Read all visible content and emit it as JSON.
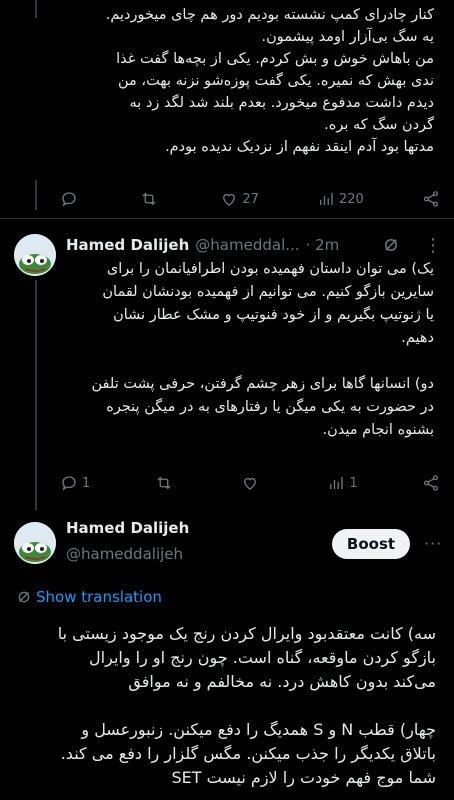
{
  "tweet1": {
    "text_lines": "کنار چادرای کمپ نشسته بودیم دور هم چای میخوردیم.\nیه سگ بی‌آزار اومد پیشمون.\nمن باهاش خوش و بش کردم. یکی از بچه‌ها گفت غذا\nندی بهش که نمیره. یکی گفت پوزه‌شو نزنه بهت، من\nدیدم داشت مدفوع میخورد. بعدم بلند شد لگد زد به\nگردن سگ که بره.\nمدتها بود آدم اینقد نفهم از نزدیک ندیده بودم.",
    "actions": {
      "replies": "",
      "retweets": "",
      "likes": "27",
      "views": "220"
    }
  },
  "tweet2": {
    "name": "Hamed Dalijeh",
    "handle": "@hameddal...",
    "time": "· 2m",
    "text": "یک) می توان داستان فهمیده بودن اطرافیانمان را برای\nسایرین بازگو کنیم. می توانیم از فهمیده بودنشان لقمان\nیا ژنوتیپ بگیریم و از خود فنوتیپ و مشک عطار نشان\nدهیم.\n\nدو) انسانها گاها برای زهر چشم گرفتن، حرفی پشت تلفن\nدر حضورت به یکی میگن یا رفتارهای به در میگن پنجره\nبشنوه انجام میدن.",
    "actions": {
      "replies": "1",
      "retweets": "",
      "likes": "",
      "views": "1"
    }
  },
  "tweet3": {
    "name": "Hamed Dalijeh",
    "handle": "@hameddalijeh",
    "boost_label": "Boost",
    "more": "···",
    "show_translation": "Show translation",
    "text": "سه) کانت معتقدبود وایرال کردن رنج یک موجود زیستی با\nبازگو کردن ماوقعه، گناه است. چون رنج او را وایرال\nمی‌کند بدون کاهش درد. نه مخالفم و نه موافق\n\nچهار) قطب N و S همدیگ را دفع میکنن. زنبورعسل و\nباتلاق یکدیگر را جذب میکنن. مگس گلزار را دفع می کند.\nشما موج فهم خودت را لازم نیست SET"
  }
}
